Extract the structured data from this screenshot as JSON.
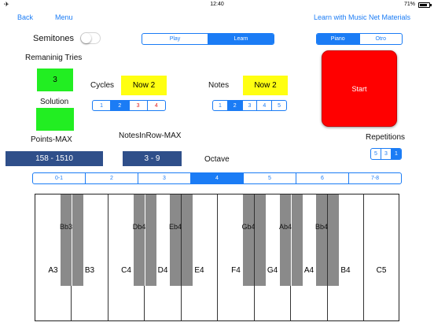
{
  "status_bar": {
    "time": "12:40",
    "battery": "71%"
  },
  "nav": {
    "back": "Back",
    "menu": "Menu",
    "materials": "Learn with Music Net Materials"
  },
  "semitones_label": "Semitones",
  "mode_segment": {
    "items": [
      "Play",
      "Learn"
    ],
    "selected": 1
  },
  "instrument_segment": {
    "items": [
      "Piano",
      "Otro"
    ],
    "selected": 0
  },
  "remaining_tries": {
    "label": "Remaninig Tries",
    "value": "3"
  },
  "solution": {
    "label": "Solution",
    "value": ""
  },
  "cycles": {
    "label": "Cycles",
    "value": "Now 2",
    "options": [
      "1",
      "2",
      "3",
      "4"
    ],
    "selected": 1
  },
  "notes": {
    "label": "Notes",
    "value": "Now 2",
    "options": [
      "1",
      "2",
      "3",
      "4",
      "5"
    ],
    "selected": 1
  },
  "start_button": "Start",
  "points_max": {
    "label": "Points-MAX",
    "value": "158 - 1510"
  },
  "notes_in_row_max": {
    "label": "NotesInRow-MAX",
    "value": "3 - 9"
  },
  "octave": {
    "label": "Octave",
    "options": [
      "0-1",
      "2",
      "3",
      "4",
      "5",
      "6",
      "7-8"
    ],
    "selected": 3
  },
  "repetitions": {
    "label": "Repetitions",
    "options": [
      "5",
      "3",
      "1"
    ],
    "selected": 2
  },
  "colors": {
    "accent": "#1b7cf5",
    "start": "#ff0000",
    "green": "#22ee22",
    "yellow": "#ffff11",
    "navy": "#2f4f8a"
  },
  "keyboard": {
    "white_keys": [
      "A3",
      "B3",
      "C4",
      "D4",
      "E4",
      "F4",
      "G4",
      "A4",
      "B4",
      "C5"
    ],
    "black_keys": [
      "Bb3",
      "Db4",
      "Eb4",
      "Gb4",
      "Ab4",
      "Bb4"
    ]
  }
}
